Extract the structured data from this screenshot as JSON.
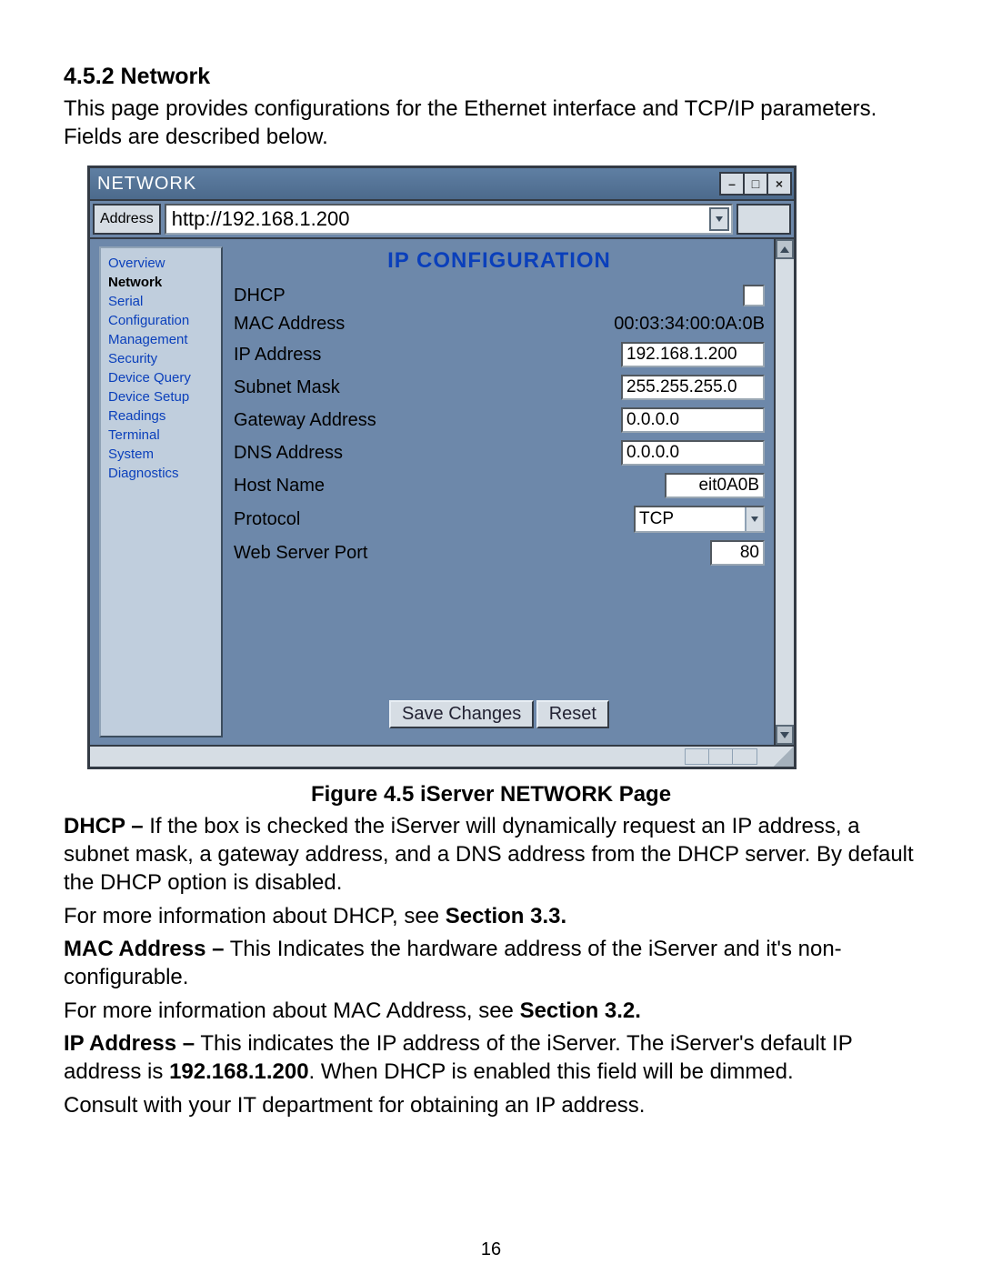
{
  "doc": {
    "section_number": "4.5.2 Network",
    "intro": "This page provides configurations for the Ethernet interface and TCP/IP parameters. Fields are described below.",
    "figure_caption": "Figure 4.5  iServer NETWORK Page",
    "dhcp_label": "DHCP –",
    "dhcp_desc": " If the box is checked the iServer will dynamically request an IP address, a subnet mask, a gateway address, and a DNS address from the DHCP server. By default the DHCP option is disabled.",
    "dhcp_more_pre": "For more information about DHCP, see ",
    "dhcp_more_bold": "Section 3.3.",
    "mac_label": "MAC Address –",
    "mac_desc": " This Indicates the hardware address of the iServer and it's non-configurable.",
    "mac_more_pre": "For more information about MAC Address, see ",
    "mac_more_bold": "Section 3.2.",
    "ip_label": "IP Address –",
    "ip_desc_1": " This indicates the IP address of the iServer. The iServer's default IP address is ",
    "ip_desc_bold": "192.168.1.200",
    "ip_desc_2": ". When DHCP is enabled this field will be dimmed.",
    "consult": "Consult with your IT department for obtaining an IP address.",
    "page_number": "16"
  },
  "window": {
    "title": "NETWORK",
    "address_label": "Address",
    "address_value": "http://192.168.1.200",
    "minimize_glyph": "–",
    "maximize_glyph": "□",
    "close_glyph": "×"
  },
  "sidebar": {
    "items": [
      {
        "label": "Overview"
      },
      {
        "label": "Network"
      },
      {
        "label": "Serial"
      },
      {
        "label": "Configuration"
      },
      {
        "label": "Management"
      },
      {
        "label": "Security"
      },
      {
        "label": "Device Query"
      },
      {
        "label": "Device Setup"
      },
      {
        "label": "Readings"
      },
      {
        "label": "Terminal"
      },
      {
        "label": "System"
      },
      {
        "label": "Diagnostics"
      }
    ],
    "active_index": 1
  },
  "content": {
    "title": "IP CONFIGURATION",
    "rows": {
      "dhcp": {
        "label": "DHCP"
      },
      "mac": {
        "label": "MAC Address",
        "value": "00:03:34:00:0A:0B"
      },
      "ip": {
        "label": "IP Address",
        "value": "192.168.1.200"
      },
      "subnet": {
        "label": "Subnet Mask",
        "value": "255.255.255.0"
      },
      "gateway": {
        "label": "Gateway Address",
        "value": "0.0.0.0"
      },
      "dns": {
        "label": "DNS Address",
        "value": "0.0.0.0"
      },
      "host": {
        "label": "Host Name",
        "value": "eit0A0B"
      },
      "protocol": {
        "label": "Protocol",
        "value": "TCP"
      },
      "port": {
        "label": "Web Server Port",
        "value": "80"
      }
    },
    "buttons": {
      "save": "Save Changes",
      "reset": "Reset"
    }
  }
}
